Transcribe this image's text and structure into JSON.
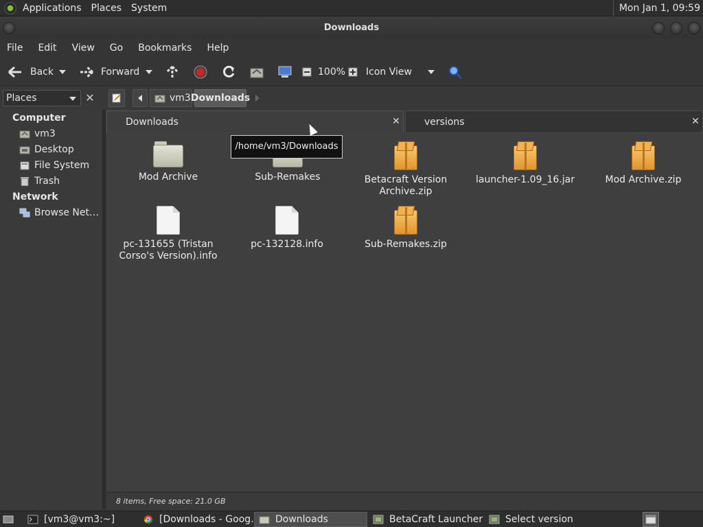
{
  "top_panel": {
    "menus": [
      "Applications",
      "Places",
      "System"
    ],
    "clock": "Mon Jan  1, 09:59"
  },
  "window": {
    "title": "Downloads"
  },
  "menubar": [
    "File",
    "Edit",
    "View",
    "Go",
    "Bookmarks",
    "Help"
  ],
  "toolbar": {
    "back_label": "Back",
    "forward_label": "Forward",
    "zoom": "100%",
    "view_mode": "Icon View"
  },
  "location": {
    "places_label": "Places",
    "crumbs": [
      "vm3",
      "Downloads"
    ]
  },
  "sidebar": {
    "computer_heading": "Computer",
    "computer_items": [
      "vm3",
      "Desktop",
      "File System",
      "Trash"
    ],
    "network_heading": "Network",
    "network_items": [
      "Browse Net…"
    ]
  },
  "tabs": [
    "Downloads",
    "versions"
  ],
  "tooltip": "/home/vm3/Downloads",
  "files": [
    {
      "name": "Mod Archive",
      "icon": "folder-icon"
    },
    {
      "name": "Sub-Remakes",
      "icon": "folder-icon"
    },
    {
      "name": "Betacraft Version Archive.zip",
      "icon": "archive-icon"
    },
    {
      "name": "launcher-1.09_16.jar",
      "icon": "archive-icon"
    },
    {
      "name": "Mod Archive.zip",
      "icon": "archive-icon"
    },
    {
      "name": "pc-131655 (Tristan Corso's Version).info",
      "icon": "document-icon"
    },
    {
      "name": "pc-132128.info",
      "icon": "document-icon"
    },
    {
      "name": "Sub-Remakes.zip",
      "icon": "archive-icon"
    }
  ],
  "status": "8 items, Free space: 21.0 GB",
  "taskbar": [
    {
      "label": "[vm3@vm3:~]",
      "icon": "terminal-icon"
    },
    {
      "label": "[Downloads - Goog…",
      "icon": "chrome-icon"
    },
    {
      "label": "Downloads",
      "icon": "folder-icon"
    },
    {
      "label": "BetaCraft Launcher …",
      "icon": "betacraft-icon"
    },
    {
      "label": "Select version",
      "icon": "betacraft-icon"
    }
  ],
  "colors": {
    "panel": "#2e2e2e",
    "window_bg": "#3f3f3f",
    "archive": "#f0a840",
    "selection": "#5a5a5a"
  }
}
